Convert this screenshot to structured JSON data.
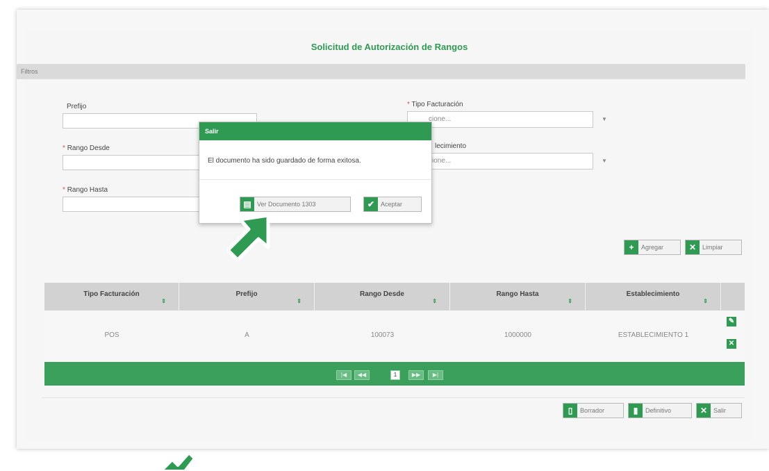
{
  "page": {
    "title": "Solicitud de Autorización de Rangos"
  },
  "filters": {
    "bar_label": "Filtros",
    "prefijo": {
      "label": "Prefijo",
      "value": ""
    },
    "rango_desde": {
      "label": "Rango Desde",
      "required_mark": "*",
      "value": ""
    },
    "rango_hasta": {
      "label": "Rango Hasta",
      "required_mark": "*",
      "value": ""
    },
    "tipo_facturacion": {
      "label": "Tipo Facturación",
      "required_mark": "*",
      "selected": "cione..."
    },
    "establecimiento": {
      "label": "lecimiento",
      "selected": "cione..."
    }
  },
  "actions": {
    "add_label": "Agregar",
    "clear_label": "Limpiar"
  },
  "table": {
    "columns": [
      "Tipo Facturación",
      "Prefijo",
      "Rango Desde",
      "Rango Hasta",
      "Establecimiento"
    ],
    "rows": [
      {
        "tipo": "POS",
        "prefijo": "A",
        "desde": "100073",
        "hasta": "1000000",
        "establecimiento": "ESTABLECIMIENTO 1"
      }
    ],
    "pager": {
      "first": "|◀",
      "prev": "◀◀",
      "current": "1",
      "next": "▶▶",
      "last": "▶|"
    }
  },
  "footer": {
    "draft_label": "Borrador",
    "final_label": "Definitivo",
    "exit_label": "Salir"
  },
  "dialog": {
    "title": "Salir",
    "message": "El documento ha sido guardado de forma exitosa.",
    "view_doc_label": "Ver Documento 1303",
    "accept_label": "Aceptar"
  },
  "colors": {
    "accent": "#2e9a52",
    "pager": "#3aa05c",
    "header_gray": "#d2d2d2"
  },
  "icons": [
    "sort-icon",
    "edit-icon",
    "delete-icon",
    "add-icon",
    "clear-icon",
    "draft-icon",
    "final-icon",
    "exit-icon",
    "document-icon",
    "check-icon",
    "pointer-arrow-icon"
  ]
}
